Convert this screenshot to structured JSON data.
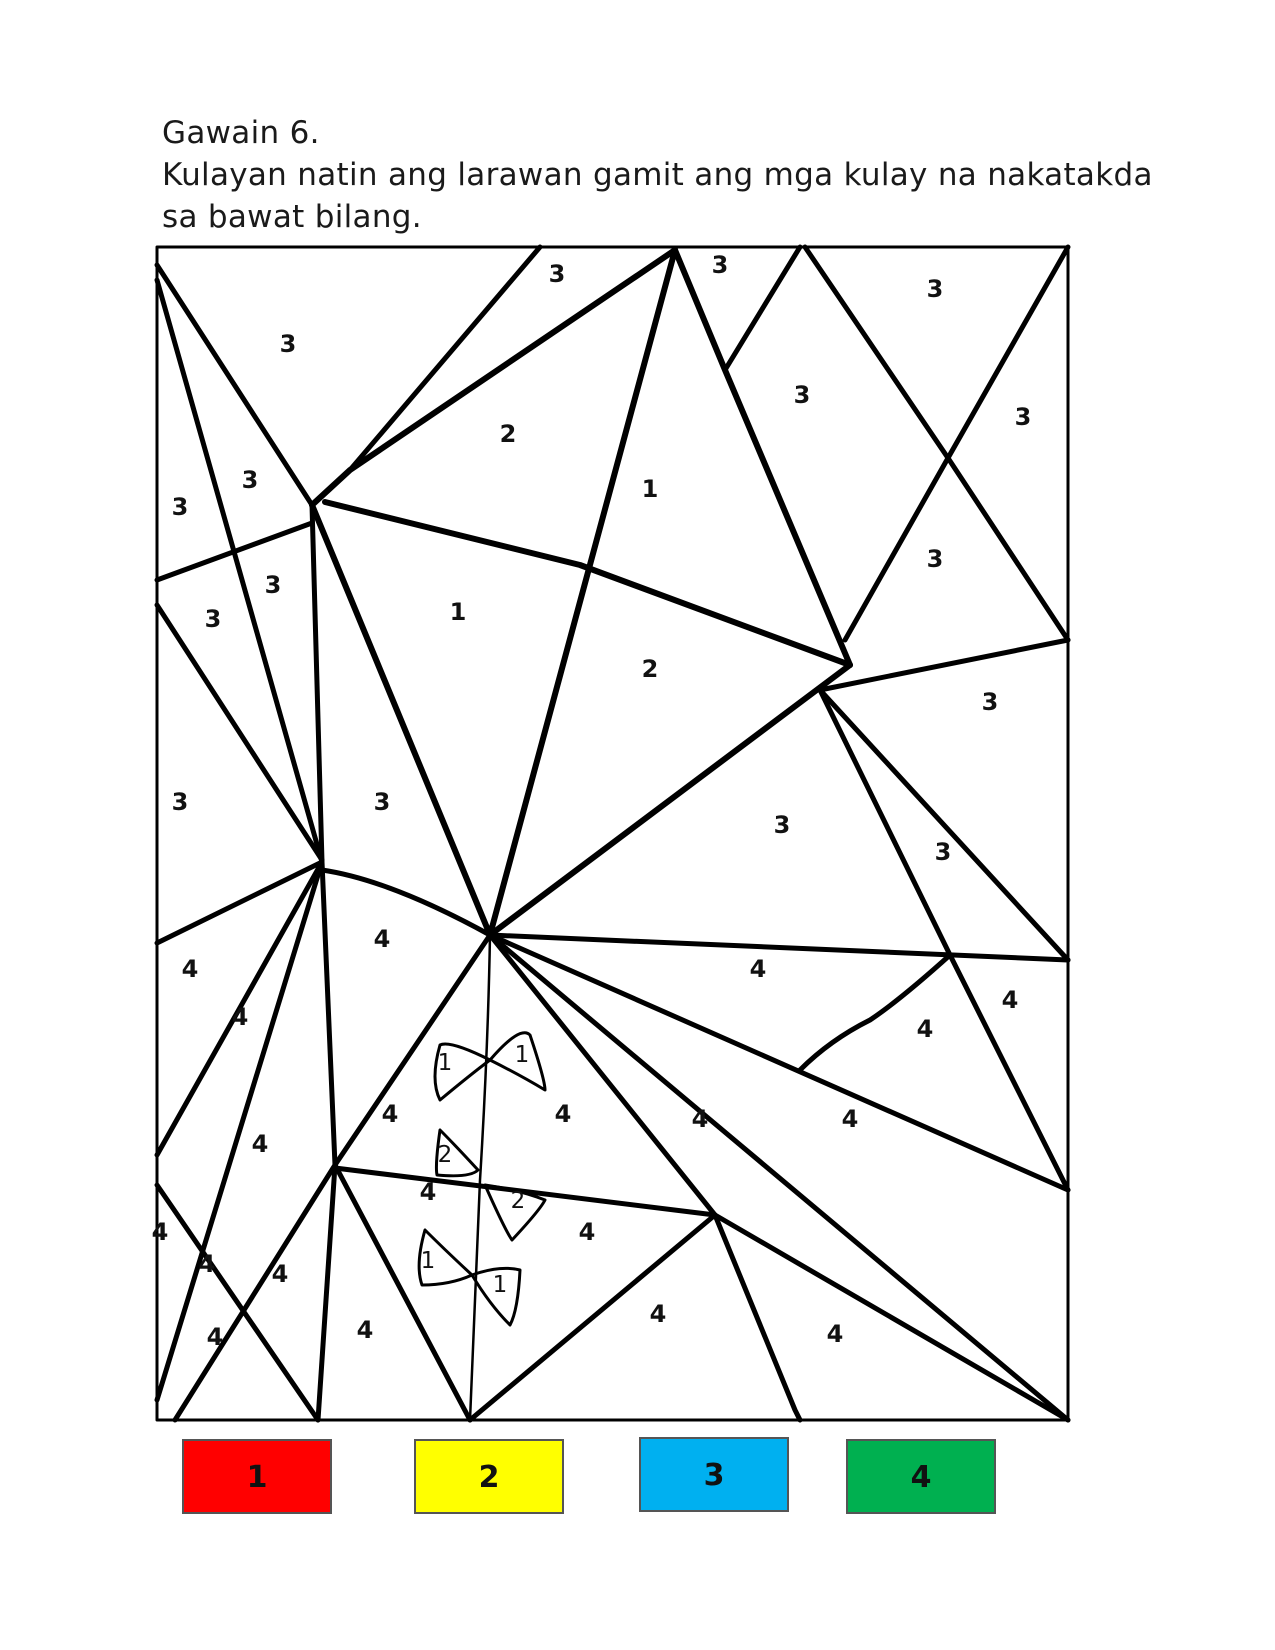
{
  "instructions": {
    "title": "Gawain 6.",
    "line1": "Kulayan natin ang larawan gamit ang mga kulay na nakatakda",
    "line2": "sa bawat bilang."
  },
  "region_numbers": {
    "sky": [
      "3",
      "3",
      "3",
      "3",
      "3",
      "3",
      "3",
      "3",
      "3",
      "3",
      "3",
      "3",
      "3",
      "3",
      "3",
      "3",
      "3",
      "3"
    ],
    "kite": [
      "2",
      "1",
      "1",
      "2"
    ],
    "ground": [
      "4",
      "4",
      "4",
      "4",
      "4",
      "4",
      "4",
      "4",
      "4",
      "4",
      "4",
      "4",
      "4",
      "4",
      "4",
      "4",
      "4",
      "4",
      "4",
      "4",
      "4",
      "4"
    ],
    "bows": [
      "1",
      "1",
      "2",
      "2",
      "1",
      "1"
    ]
  },
  "legend": [
    {
      "number": "1",
      "color": "#ff0000"
    },
    {
      "number": "2",
      "color": "#ffff00"
    },
    {
      "number": "3",
      "color": "#00b0f0"
    },
    {
      "number": "4",
      "color": "#00b050"
    }
  ]
}
